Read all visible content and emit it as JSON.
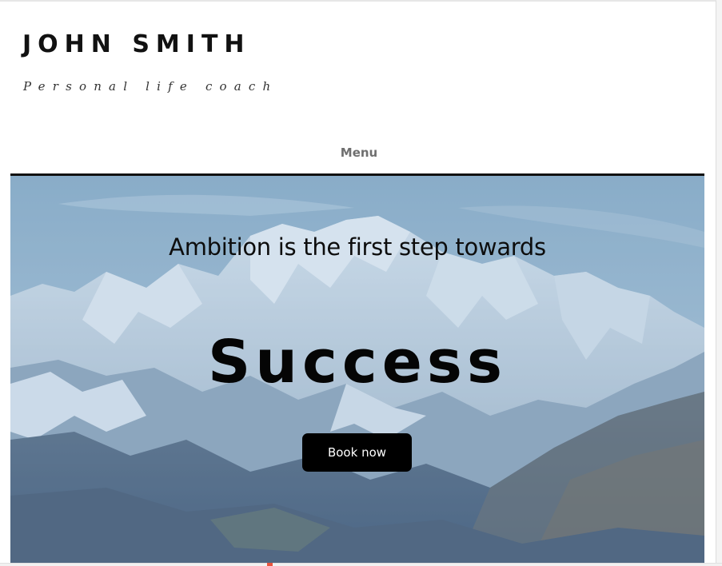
{
  "header": {
    "site_title": "JOHN SMITH",
    "tagline": "Personal life coach"
  },
  "nav": {
    "menu_label": "Menu"
  },
  "hero": {
    "subtitle": "Ambition is the first step towards",
    "title": "Success",
    "cta_label": "Book now",
    "background": "snowy-mountain-range-photo"
  },
  "colors": {
    "text": "#111111",
    "menu_text": "#6f6f6f",
    "button_bg": "#000000",
    "button_text": "#ffffff"
  }
}
